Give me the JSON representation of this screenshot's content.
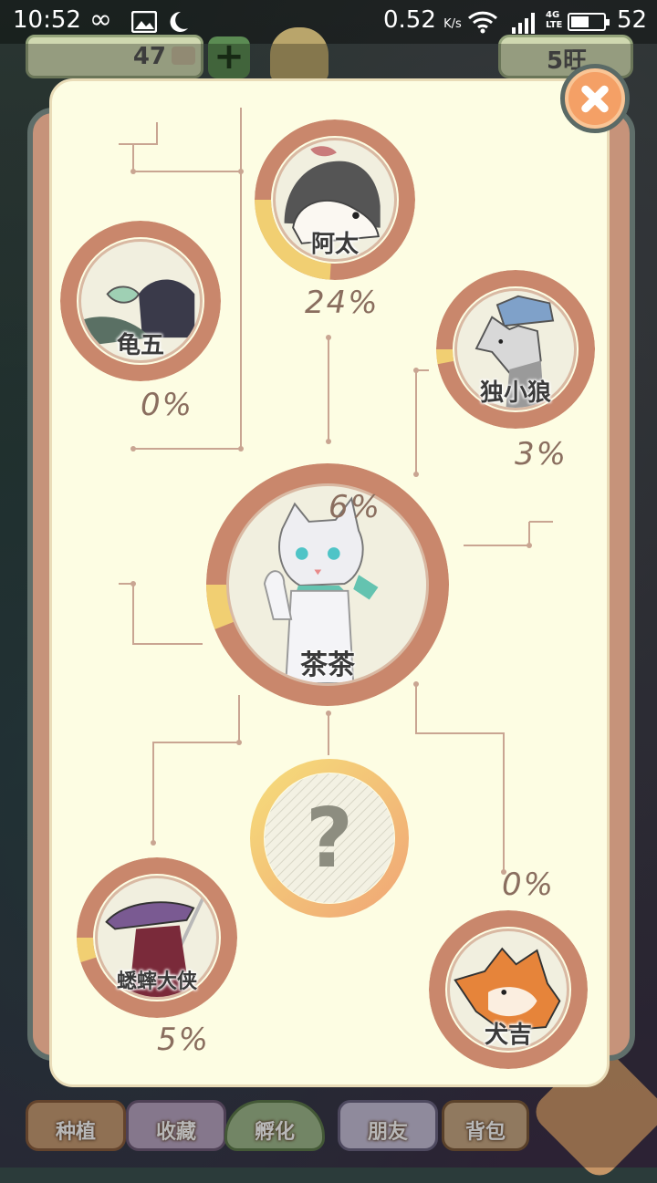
{
  "status_bar": {
    "time": "10:52",
    "speed_value": "0.52",
    "speed_unit": "K/s",
    "network": "4G\nLTE",
    "battery": "52",
    "icons": [
      "infinity-icon",
      "image-icon",
      "moon-icon",
      "wifi-icon",
      "signal-icon",
      "battery-icon"
    ]
  },
  "hud": {
    "coins": "47",
    "flowers": "5旺"
  },
  "nav": {
    "items": [
      {
        "label": "种植"
      },
      {
        "label": "收藏"
      },
      {
        "label": "孵化"
      },
      {
        "label": "朋友"
      },
      {
        "label": "背包"
      }
    ]
  },
  "modal": {
    "characters": [
      {
        "id": "atai",
        "name": "阿太",
        "percent": "24%",
        "progress": 0.24
      },
      {
        "id": "guiwu",
        "name": "龟五",
        "percent": "0%",
        "progress": 0
      },
      {
        "id": "duxiaolang",
        "name": "独小狼",
        "percent": "3%",
        "progress": 0.03
      },
      {
        "id": "chacha",
        "name": "茶茶",
        "percent": "6%",
        "progress": 0.06
      },
      {
        "id": "xishuai",
        "name": "蟋蟀大侠",
        "percent": "5%",
        "progress": 0.05
      },
      {
        "id": "quanji",
        "name": "犬吉",
        "percent": "0%",
        "progress": 0
      }
    ],
    "unknown_symbol": "?"
  },
  "colors": {
    "panel": "#fdfde3",
    "ring": "#c9876c",
    "progress": "#f1cf72",
    "line": "#c9a592",
    "close": "#f4a066"
  }
}
